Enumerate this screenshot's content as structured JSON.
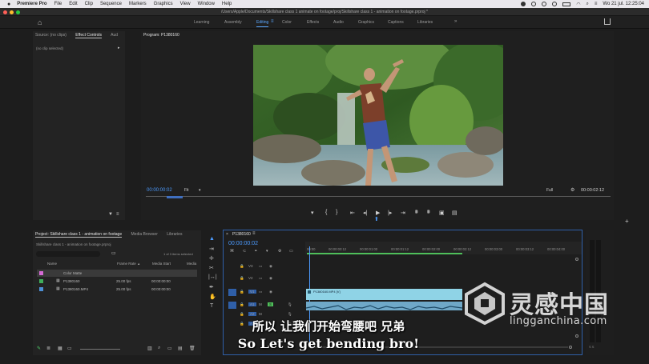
{
  "menubar": {
    "app_name": "Premiere Pro",
    "items": [
      "File",
      "Edit",
      "Clip",
      "Sequence",
      "Markers",
      "Graphics",
      "View",
      "Window",
      "Help"
    ],
    "clock": "Wo 21 jul.  12:25:04"
  },
  "window": {
    "title": "/Users/Apple/Documents/Skillshare class 1 animate on footage/proj/Skillshare class 1 - animation on footage.prproj *"
  },
  "workspaces": {
    "tabs": [
      "Learning",
      "Assembly",
      "Editing",
      "Color",
      "Effects",
      "Audio",
      "Graphics",
      "Captions",
      "Libraries"
    ],
    "active": "Editing"
  },
  "source_panel": {
    "tabs": [
      "Source: (no clips)",
      "Effect Controls",
      "Aud"
    ],
    "active_tab": "Effect Controls",
    "empty_message": "(no clip selected)"
  },
  "program_monitor": {
    "title": "Program: P1380160",
    "timecode_current": "00:00:00:02",
    "fit_label": "Fit",
    "quality_label": "Full",
    "timecode_duration": "00:00:02:12"
  },
  "project_panel": {
    "tabs": [
      "Project: Skillshare class 1 - animation on footage",
      "Media Browser",
      "Libraries"
    ],
    "path": "Skillshare class 1 - animation on footage.prproj",
    "selection_status": "1 of 3 items selected",
    "columns": [
      "Name",
      "Frame Rate",
      "Media Start",
      "Media"
    ],
    "items": [
      {
        "name": "Color Matte",
        "frame_rate": "",
        "media_start": "",
        "color": "#d56bd5"
      },
      {
        "name": "P1380160",
        "frame_rate": "25.00 fps",
        "media_start": "00:00:00:00",
        "color": "#3fae5a"
      },
      {
        "name": "P1380160.MP4",
        "frame_rate": "25.00 fps",
        "media_start": "00:00:00:00",
        "color": "#4d8fd6"
      }
    ]
  },
  "timeline": {
    "sequence_name": "P1380160",
    "timecode": "00:00:00:02",
    "ruler_labels": [
      "00:00",
      "00:00:00:12",
      "00:00:01:00",
      "00:00:01:12",
      "00:00:02:00",
      "00:00:02:12",
      "00:00:03:00",
      "00:00:03:12",
      "00:00:04:00"
    ],
    "video_tracks": [
      "V3",
      "V2",
      "V1"
    ],
    "audio_tracks": [
      "A1",
      "A2",
      "A3"
    ],
    "video_clip_label": "P1380160.MP4 [V]",
    "colors": {
      "video_clip": "#8fd3e6",
      "audio_clip": "#6fa8c8",
      "accent": "#2f5fa8",
      "timecode": "#4c9bff"
    }
  },
  "subtitles": {
    "chinese": "所以 让我们开始弯腰吧 兄弟",
    "english": "So Let's get bending bro!"
  },
  "watermark": {
    "chinese": "灵感中国",
    "url": "lingganchina.com"
  },
  "icons": [
    "home-icon",
    "play-icon",
    "step-back-icon",
    "step-forward-icon",
    "wrench-icon",
    "filter-icon",
    "selection-tool-icon",
    "razor-tool-icon",
    "hand-tool-icon",
    "type-tool-icon",
    "camera-icon",
    "export-icon"
  ]
}
